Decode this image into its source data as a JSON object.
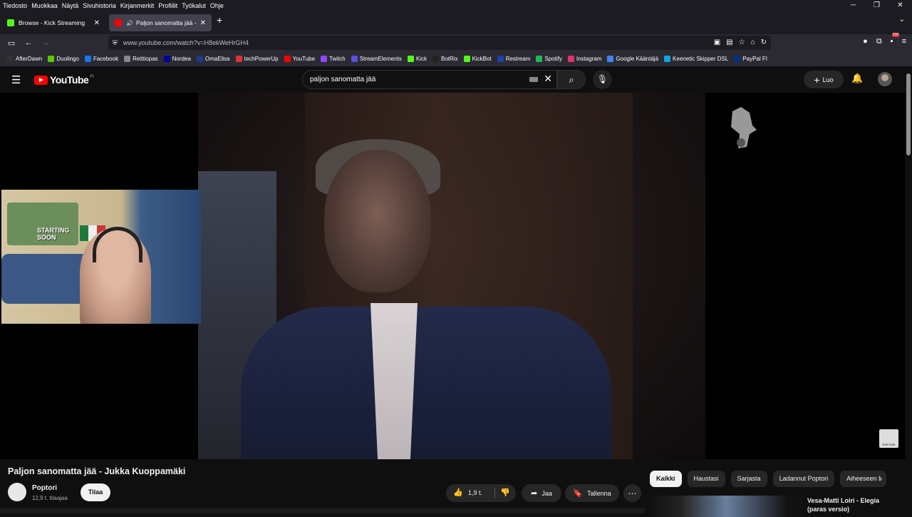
{
  "menubar": [
    "Tiedosto",
    "Muokkaa",
    "Näytä",
    "Sivuhistoria",
    "Kirjanmerkit",
    "Profiilit",
    "Työkalut",
    "Ohje"
  ],
  "tabs": [
    {
      "label": "Browse - Kick Streaming",
      "color": "#53fc18"
    },
    {
      "label": "Paljon sanomatta jää - Jukk",
      "color": "#ff0000"
    }
  ],
  "nav": {
    "url": "www.youtube.com/watch?v=H8ekWeHrGH4",
    "badge": "298"
  },
  "bookmarks": [
    {
      "label": "AfterDawn",
      "color": "#333333"
    },
    {
      "label": "Duolingo",
      "color": "#58cc02"
    },
    {
      "label": "Facebook",
      "color": "#1877f2"
    },
    {
      "label": "Reittiopas",
      "color": "#888888"
    },
    {
      "label": "Nordea",
      "color": "#0000a0"
    },
    {
      "label": "OmaElisa",
      "color": "#1e3a8a"
    },
    {
      "label": "techPowerUp",
      "color": "#d33"
    },
    {
      "label": "YouTube",
      "color": "#ff0000"
    },
    {
      "label": "Twitch",
      "color": "#9146ff"
    },
    {
      "label": "StreamElements",
      "color": "#5c4ee5"
    },
    {
      "label": "Kick",
      "color": "#53fc18"
    },
    {
      "label": "BotRix",
      "color": "#222222"
    },
    {
      "label": "KickBot",
      "color": "#53fc18"
    },
    {
      "label": "Restream",
      "color": "#1e40af"
    },
    {
      "label": "Spotify",
      "color": "#1db954"
    },
    {
      "label": "Instagram",
      "color": "#e1306c"
    },
    {
      "label": "Google Kääntäjä",
      "color": "#4285f4"
    },
    {
      "label": "Keenetic Skipper DSL",
      "color": "#0ea5e9"
    },
    {
      "label": "PayPal FI",
      "color": "#003087"
    }
  ],
  "youtube": {
    "logo": "YouTube",
    "region": "FI",
    "search_value": "paljon sanomatta jää",
    "create_label": "Luo"
  },
  "webcam": {
    "poster_text": "STARTING SOON"
  },
  "watermark": "POPTORI",
  "video": {
    "title": "Paljon sanomatta jää - Jukka Kuoppamäki",
    "channel": "Poptori",
    "subscribers": "12,9 t. tilaajaa",
    "subscribe_label": "Tilaa",
    "likes": "1,9 t.",
    "share_label": "Jaa",
    "save_label": "Tallenna"
  },
  "chips": [
    "Kaikki",
    "Haustasi",
    "Sarjasta",
    "Ladannut Poptori",
    "Aiheeseen l"
  ],
  "recommendation": {
    "title": "Vesa-Matti Loiri - Elegia (paras versio)"
  }
}
